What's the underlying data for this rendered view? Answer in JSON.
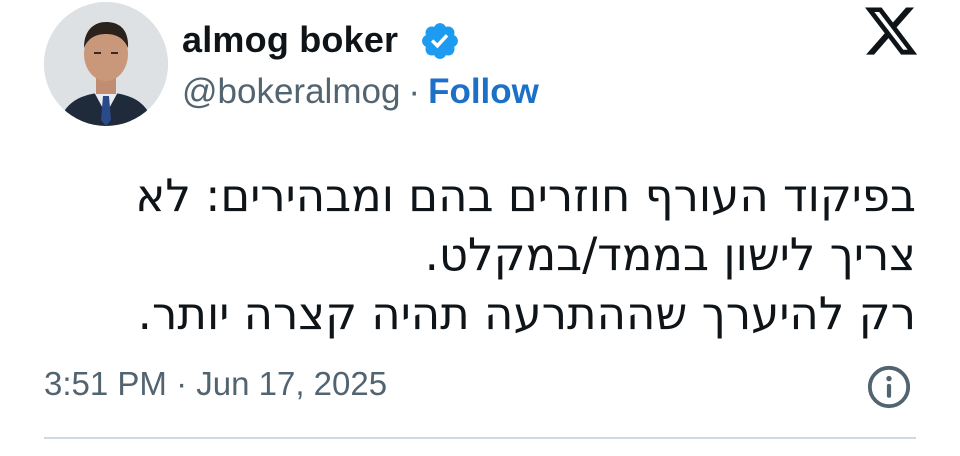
{
  "author": {
    "display_name": "almog boker",
    "handle": "@bokeralmog",
    "separator": "·",
    "follow_label": "Follow",
    "avatar_icon": "profile-photo",
    "verified_icon": "verified-badge-icon",
    "verified_color": "#1d9bf0"
  },
  "platform": {
    "logo_icon": "x-logo-icon"
  },
  "tweet": {
    "lines": [
      "בפיקוד העורף חוזרים בהם ומבהירים: לא",
      "צריך לישון בממד/במקלט.",
      "רק להיערך שההתרעה תהיה קצרה יותר."
    ]
  },
  "meta": {
    "time": "3:51 PM",
    "separator": "·",
    "date": "Jun 17, 2025",
    "info_icon": "info-icon"
  },
  "colors": {
    "text": "#0f1419",
    "secondary": "#536471",
    "link": "#1d70c8",
    "divider": "#cfd9de"
  }
}
